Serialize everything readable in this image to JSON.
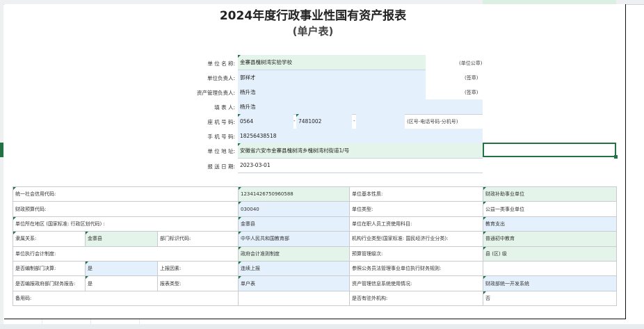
{
  "title": "2024年度行政事业性国有资产报表",
  "subtitle": "(单户表)",
  "form": {
    "unit_name_label": "单 位 名 称:",
    "unit_name": "金寨县槐树湾实验学校",
    "unit_seal": "(单位公章)",
    "leader_label": "单位负责人:",
    "leader": "郭祥才",
    "leader_sign": "(签章)",
    "asset_mgr_label": "资产管理负责人:",
    "asset_mgr": "杨升浩",
    "asset_mgr_sign": "(签章)",
    "filler_label": "填   表   人:",
    "filler": "杨升浩",
    "phone_label": "座 机 号 码:",
    "phone_area": "0564",
    "phone_sep1": "-",
    "phone_num": "7481002",
    "phone_sep2": "-",
    "phone_hint": "(区号-电话号码-分机号)",
    "mobile_label": "手 机 号 码:",
    "mobile": "18256438518",
    "address_label": "单 位 地 址:",
    "address": "安徽省六安市金寨县槐树湾乡槐树湾村街道1/号",
    "date_label": "报 送 日 期:",
    "date": "2023-03-01"
  },
  "grid": {
    "r1": [
      "统一社会信用代码:",
      "12341426750960588",
      "单位基本性质:",
      "财政补助事业单位"
    ],
    "r2": [
      "财政预算代码:",
      "030040",
      "单位类型:",
      "公益一类事业单位"
    ],
    "r3": [
      "单位所在地区 (国家标准: 行政区划代码) :",
      "金寨县",
      "单位在职人员工资使用科目:",
      "教育支出"
    ],
    "r4": [
      "隶属关系:",
      "金寨县",
      "部门标识代码:",
      "中华人民共和国教育部",
      "机构行业类型(国家标准: 国民经济行业分类):",
      "普通初中教育"
    ],
    "r5": [
      "单位执行会计制度:",
      "政府会计准则制度",
      "预算管理级次:",
      "县 (区) 级"
    ],
    "r6": [
      "是否编制部门决算:",
      "是",
      "上报因素:",
      "连续上报",
      "参照公务员法管理事业单位执行财务规则:",
      ""
    ],
    "r7": [
      "是否编报政府部门财务报告:",
      "是",
      "报表类型:",
      "单户表",
      "资产管理信息系统使用情况:",
      "财政部统一开发系统"
    ],
    "r8": [
      "备用码:",
      "",
      "是否有驻外机构:",
      "否"
    ]
  }
}
